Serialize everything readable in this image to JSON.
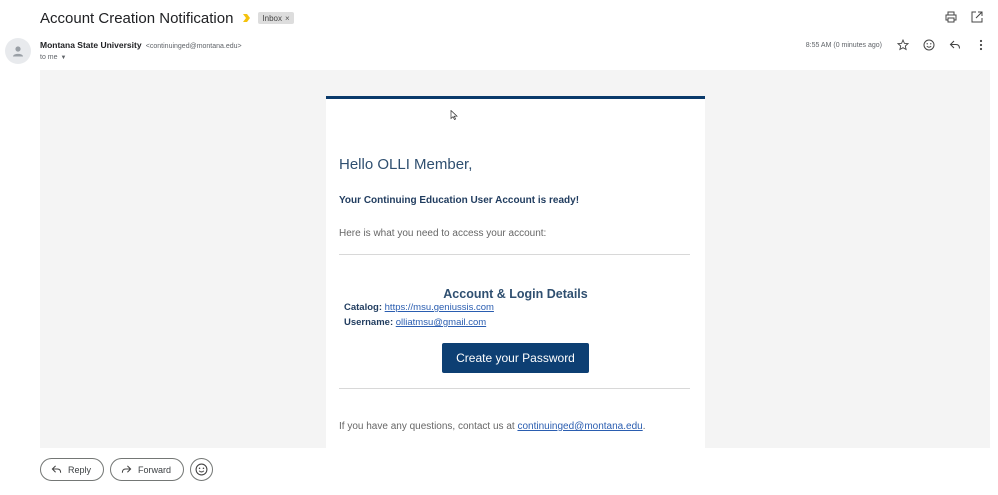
{
  "subject": {
    "title": "Account Creation Notification",
    "label_chip": "Inbox",
    "label_remove": "×"
  },
  "sender": {
    "name": "Montana State University",
    "email": "<continuinged@montana.edu>",
    "to": "to me",
    "timestamp": "8:55 AM (0 minutes ago)"
  },
  "email": {
    "greeting": "Hello OLLI Member,",
    "ready": "Your Continuing Education User Account is ready!",
    "access": "Here is what you need to access your account:",
    "details_title": "Account & Login Details",
    "catalog_label": "Catalog:",
    "catalog_link": "https://msu.geniussis.com",
    "username_label": "Username:",
    "username_value": "olliatmsu@gmail.com",
    "create_button": "Create your Password",
    "questions_prefix": "If you have any questions, contact us at ",
    "questions_email": "continuinged@montana.edu",
    "questions_suffix": "."
  },
  "actions": {
    "reply": "Reply",
    "forward": "Forward"
  },
  "colors": {
    "accent": "#0a3a6b",
    "button": "#0d3f73",
    "importance": "#f4c20d",
    "link": "#2a5db0"
  },
  "icons": [
    "importance-marker-icon",
    "print-icon",
    "open-new-window-icon",
    "avatar-person-icon",
    "star-icon",
    "emoji-icon",
    "reply-icon",
    "more-vert-icon",
    "forward-icon"
  ]
}
